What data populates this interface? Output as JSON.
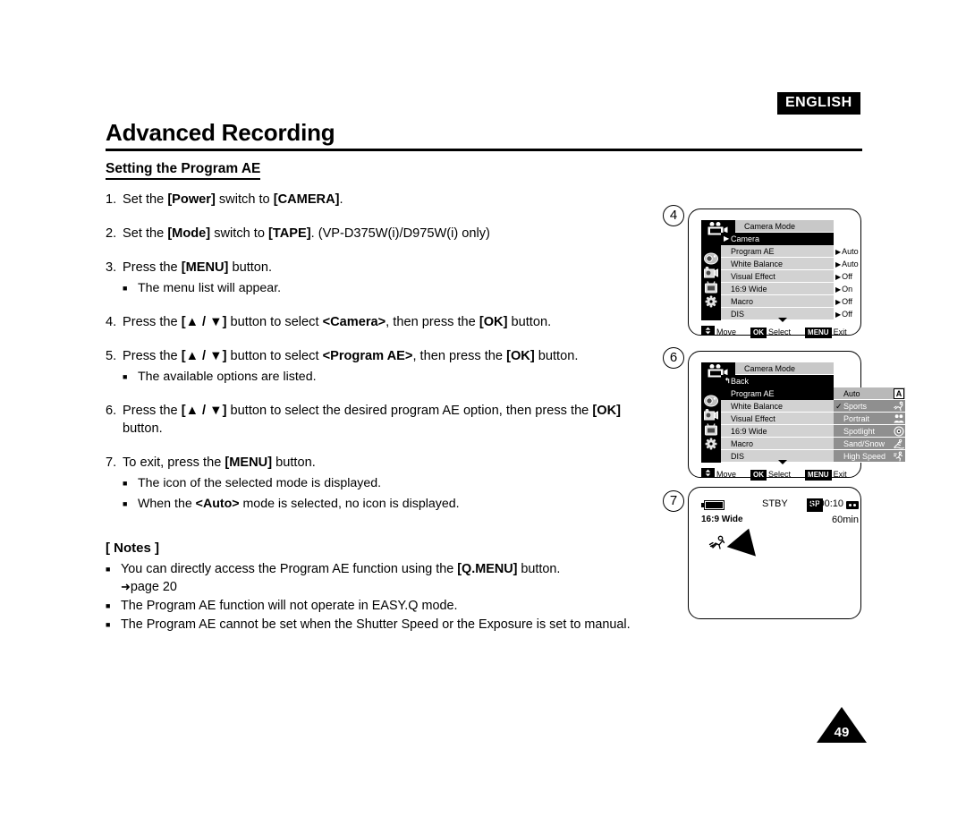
{
  "header": {
    "language_badge": "ENGLISH",
    "chapter_title": "Advanced Recording",
    "section_title": "Setting the Program AE"
  },
  "steps": [
    {
      "number": "1.",
      "text_html": "Set the <b>[Power]</b> switch to <b>[CAMERA]</b>.",
      "subs": []
    },
    {
      "number": "2.",
      "text_html": "Set the <b>[Mode]</b> switch to <b>[TAPE]</b>. (VP-D375W(i)/D975W(i) only)",
      "subs": []
    },
    {
      "number": "3.",
      "text_html": "Press the <b>[MENU]</b> button.",
      "subs": [
        "The menu list will appear."
      ]
    },
    {
      "number": "4.",
      "text_html": "Press the <b>[▲ / ▼]</b> button to select <b>&lt;Camera&gt;</b>, then press the <b>[OK]</b> button.",
      "subs": []
    },
    {
      "number": "5.",
      "text_html": "Press the <b>[▲ / ▼]</b> button to select <b>&lt;Program AE&gt;</b>, then press the <b>[OK]</b> button.",
      "subs": [
        "The available options are listed."
      ]
    },
    {
      "number": "6.",
      "text_html": "Press the <b>[▲ / ▼]</b> button to select the desired program AE option, then press the <b>[OK]</b> button.",
      "subs": []
    },
    {
      "number": "7.",
      "text_html": "To exit, press the <b>[MENU]</b> button.",
      "subs": [
        "The icon of the selected mode is displayed.",
        "When the <b>&lt;Auto&gt;</b> mode is selected, no icon is displayed."
      ]
    }
  ],
  "notes": {
    "title": "[ Notes ]",
    "items": [
      {
        "text_html": "You can directly access the Program AE function using the <b>[Q.MENU]</b> button.",
        "page_ref": "page 20",
        "page_ref_arrow": "➜"
      },
      {
        "text_html": "The Program AE function will not operate in EASY.Q mode.",
        "page_ref": "",
        "page_ref_arrow": ""
      },
      {
        "text_html": "The Program AE cannot be set when the Shutter Speed or the Exposure is set to manual.",
        "page_ref": "",
        "page_ref_arrow": ""
      }
    ]
  },
  "page_number": "49",
  "illustrations": {
    "panel4": {
      "marker": "4",
      "menu_title": "Camera Mode",
      "rows": [
        {
          "label": "Camera",
          "selected": true,
          "caret": "▶"
        },
        {
          "label": "Program AE",
          "selected": false,
          "caret": ""
        },
        {
          "label": "White Balance",
          "selected": false,
          "caret": ""
        },
        {
          "label": "Visual Effect",
          "selected": false,
          "caret": ""
        },
        {
          "label": "16:9 Wide",
          "selected": false,
          "caret": ""
        },
        {
          "label": "Macro",
          "selected": false,
          "caret": ""
        },
        {
          "label": "DIS",
          "selected": false,
          "caret": ""
        }
      ],
      "values": [
        {
          "caret": "▶",
          "label": "Auto"
        },
        {
          "caret": "▶",
          "label": "Auto"
        },
        {
          "caret": "▶",
          "label": "Off"
        },
        {
          "caret": "▶",
          "label": "On"
        },
        {
          "caret": "▶",
          "label": "Off"
        },
        {
          "caret": "▶",
          "label": "Off"
        }
      ],
      "hints": [
        {
          "key_icon": "up-down-arrow-key",
          "key_label": "",
          "label": "Move"
        },
        {
          "key_icon": "",
          "key_label": "OK",
          "label": "Select"
        },
        {
          "key_icon": "",
          "key_label": "MENU",
          "label": "Exit"
        }
      ]
    },
    "panel6": {
      "marker": "6",
      "menu_title": "Camera Mode",
      "rows": [
        {
          "label": "Back",
          "selected": true,
          "back": true
        },
        {
          "label": "Program AE",
          "selected": true,
          "back": false
        },
        {
          "label": "White Balance",
          "selected": false,
          "back": false
        },
        {
          "label": "Visual Effect",
          "selected": false,
          "back": false
        },
        {
          "label": "16:9 Wide",
          "selected": false,
          "back": false
        },
        {
          "label": "Macro",
          "selected": false,
          "back": false
        },
        {
          "label": "DIS",
          "selected": false,
          "back": false
        }
      ],
      "options": [
        {
          "label": "Auto",
          "checked": false,
          "icon": "letter-a-icon",
          "highlight": true
        },
        {
          "label": "Sports",
          "checked": true,
          "icon": "sports-icon",
          "highlight": false
        },
        {
          "label": "Portrait",
          "checked": false,
          "icon": "portrait-icon",
          "highlight": false
        },
        {
          "label": "Spotlight",
          "checked": false,
          "icon": "spotlight-icon",
          "highlight": false
        },
        {
          "label": "Sand/Snow",
          "checked": false,
          "icon": "sand-snow-icon",
          "highlight": false
        },
        {
          "label": "High Speed",
          "checked": false,
          "icon": "high-speed-icon",
          "highlight": false
        }
      ],
      "hints": [
        {
          "key_icon": "up-down-arrow-key",
          "key_label": "",
          "label": "Move"
        },
        {
          "key_icon": "",
          "key_label": "OK",
          "label": "Select"
        },
        {
          "key_icon": "",
          "key_label": "MENU",
          "label": "Exit"
        }
      ]
    },
    "panel7": {
      "marker": "7",
      "status": "STBY",
      "record_mode": "SP",
      "timecode": "0:00:10",
      "wide_label": "16:9 Wide",
      "remaining": "60min"
    }
  }
}
